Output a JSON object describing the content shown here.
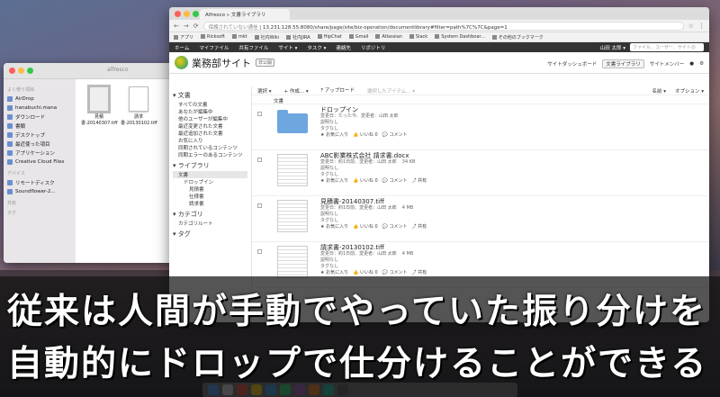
{
  "finder": {
    "title": "alfresco",
    "sections": [
      {
        "label": "よく使う項目",
        "items": [
          "AirDrop",
          "hanabuchi.mana",
          "ダウンロード",
          "書類",
          "デスクトップ",
          "最近使った項目",
          "アプリケーション",
          "Creative Cloud Files"
        ]
      },
      {
        "label": "デバイス",
        "items": [
          "リモートディスク",
          "Soundflower-2..."
        ]
      },
      {
        "label": "共有",
        "items": []
      },
      {
        "label": "タグ",
        "items": []
      }
    ],
    "files": [
      {
        "name": "見積書-20140307.tiff",
        "line1": "見積",
        "line2": "書-20140307.tiff"
      },
      {
        "name": "請求書-20130102.tiff",
        "line1": "請求",
        "line2": "書-20130102.tiff"
      }
    ]
  },
  "browser": {
    "tab_title": "Alfresco » 文書ライブラリ",
    "url_warning": "保護されていない通信",
    "url": "13.231.128.55:8080/share/page/site/biz-operation/documentlibrary#filter=path%7C%7C&page=1",
    "bookmarks": [
      "アプリ",
      "Ricksoft",
      "mkt",
      "社内Wiki",
      "社内JIRA",
      "HipChat",
      "Gmail",
      "Atlassian",
      "Slack",
      "System Dashboar...",
      "その他のブックマーク"
    ]
  },
  "alfresco": {
    "nav": [
      "ホーム",
      "マイファイル",
      "共有ファイル",
      "サイト ▾",
      "タスク ▾",
      "連絡先",
      "リポジトリ"
    ],
    "user": "山田 太郎 ▾",
    "search_placeholder": "ファイル、ユーザー、サイトの",
    "site_title": "業務部サイト",
    "site_badge": "非公開",
    "header_links": [
      "サイトダッシュボード",
      "文書ライブラリ",
      "サイトメンバー"
    ],
    "sidebar": {
      "docs_header": "▾ 文書",
      "docs_items": [
        "すべての文書",
        "あなたが編集中",
        "他のユーザーが編集中",
        "最近変更された文書",
        "最近追加された文書",
        "お気に入り",
        "同期されているコンテンツ",
        "同期エラーのあるコンテンツ"
      ],
      "library_header": "▾ ライブラリ",
      "library_items": [
        {
          "label": "文書",
          "level": 1,
          "selected": true
        },
        {
          "label": "ドロップイン",
          "level": 2
        },
        {
          "label": "見積書",
          "level": 3
        },
        {
          "label": "仕様書",
          "level": 3
        },
        {
          "label": "請求書",
          "level": 3
        }
      ],
      "category_header": "▾ カテゴリ",
      "category_items": [
        "カテゴリルート"
      ],
      "tag_header": "▾ タグ"
    },
    "toolbar": {
      "select": "選択 ▾",
      "create": "+ 作成... ▾",
      "upload": "⤒ アップロード",
      "selected": "選択したアイテム... ▾",
      "sort": "名前 ▾",
      "options": "オプション ▾"
    },
    "breadcrumb": "文書",
    "documents": [
      {
        "name": "ドロップイン",
        "type": "folder",
        "modified": "変更日：たった今、変更者：山田 太郎",
        "size": "",
        "desc": "説明なし",
        "tags": "タグなし",
        "actions": "★ お気に入り　👍 いいね 0　💬 コメント"
      },
      {
        "name": "ABC影業株式会社 請求書.docx",
        "type": "doc",
        "modified": "変更日：約1日前、変更者：山田 太郎",
        "size": "34 KB",
        "desc": "説明なし",
        "tags": "タグなし",
        "actions": "★ お気に入り　👍 いいね 0　💬 コメント　⤴ 共有"
      },
      {
        "name": "見積書-20140307.tiff",
        "type": "doc",
        "modified": "変更日：約1日前、変更者：山田 太郎",
        "size": "4 MB",
        "desc": "説明なし",
        "tags": "タグなし",
        "actions": "★ お気に入り　👍 いいね 0　💬 コメント　⤴ 共有"
      },
      {
        "name": "請求書-20130102.tiff",
        "type": "doc",
        "modified": "変更日：約1日前、変更者：山田 太郎",
        "size": "4 MB",
        "desc": "説明なし",
        "tags": "タグなし",
        "actions": "★ お気に入り　👍 いいね 0　💬 コメント　⤴ 共有"
      }
    ]
  },
  "caption": {
    "line1": "従来は人間が手動でやっていた振り分けを",
    "line2": "自動的にドロップで仕分けることができる"
  },
  "colors": {
    "nav_bg": "#333333",
    "folder": "#6ea6e0",
    "caption_bg": "#141414"
  }
}
